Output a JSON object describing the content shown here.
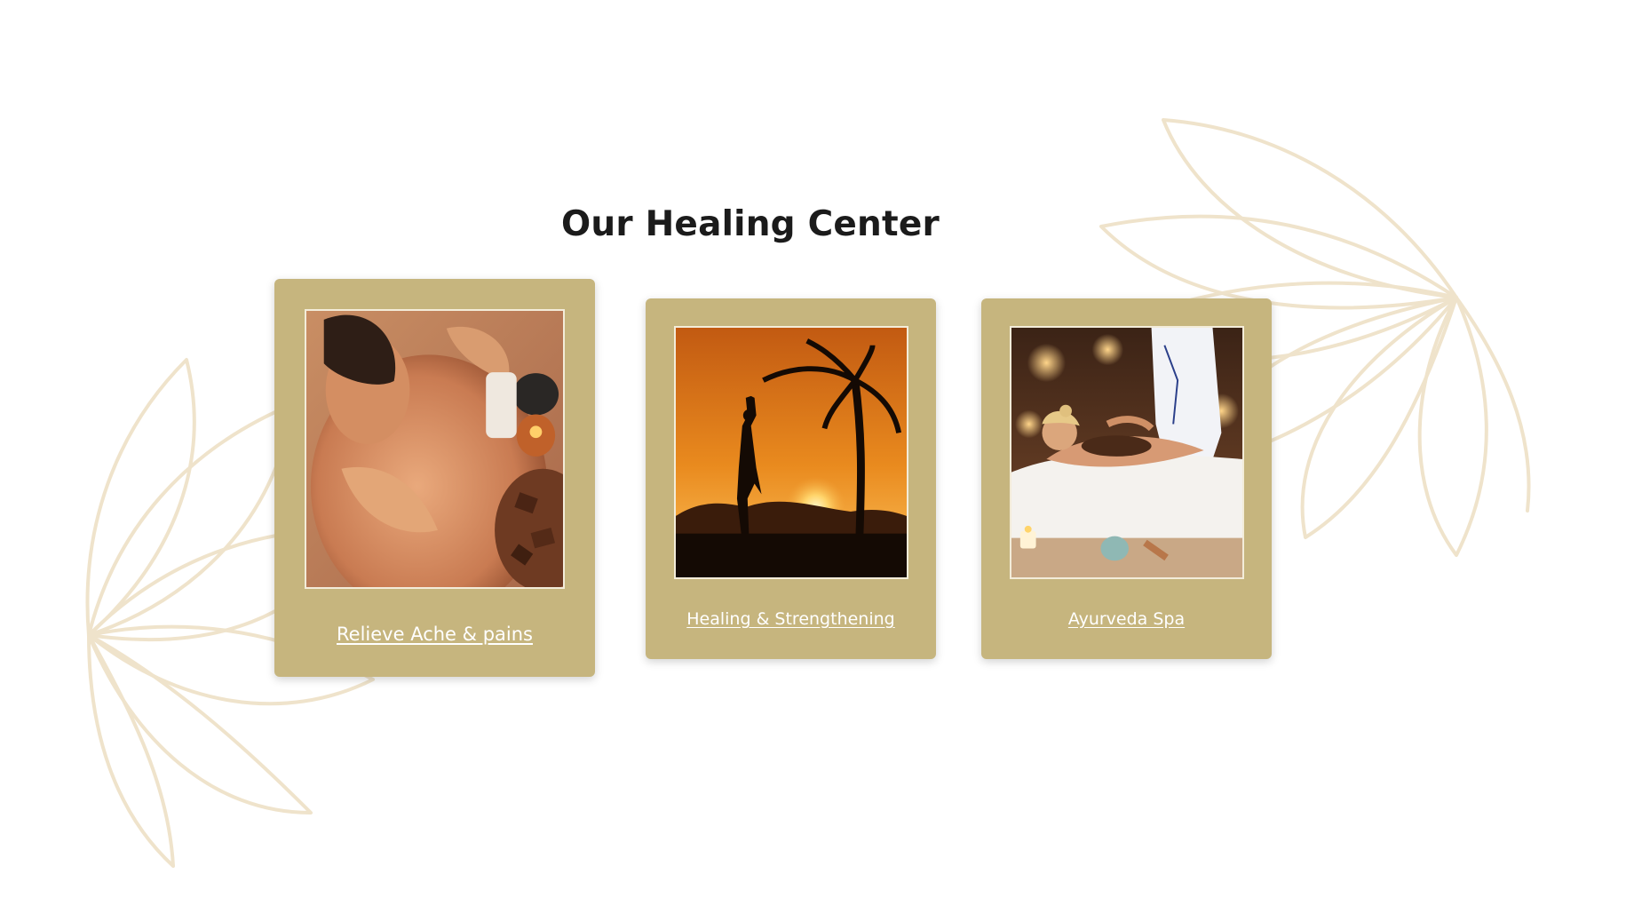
{
  "section": {
    "title": "Our Healing Center"
  },
  "cards": [
    {
      "label": "Relieve Ache & pains",
      "image": "back-massage-photo"
    },
    {
      "label": "Healing & Strengthening",
      "image": "sunset-yoga-photo"
    },
    {
      "label": "Ayurveda Spa",
      "image": "ayurveda-spa-photo"
    }
  ],
  "colors": {
    "card_background": "#c6b57e",
    "title_text": "#1b1b1b",
    "link_text": "#ffffff",
    "lotus_outline": "#efe3cb"
  }
}
